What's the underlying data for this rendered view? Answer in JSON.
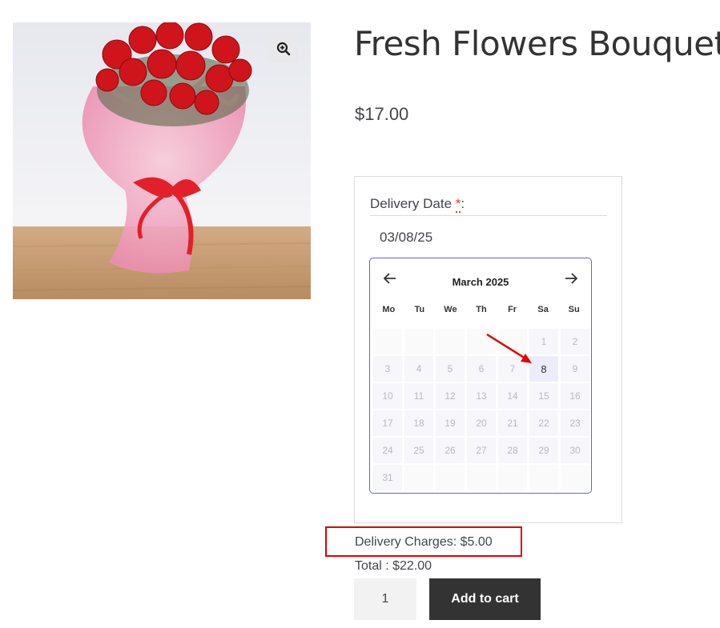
{
  "product": {
    "title": "Fresh Flowers Bouquet",
    "price": "$17.00",
    "image_icon": "bouquet-image",
    "zoom_icon": "zoom-in-icon"
  },
  "delivery": {
    "label": "Delivery Date ",
    "required_mark": "*",
    "colon": ":",
    "input_value": "03/08/25"
  },
  "calendar": {
    "month_label": "March 2025",
    "prev_icon": "arrow-left-icon",
    "next_icon": "arrow-right-icon",
    "weekdays": [
      "Mo",
      "Tu",
      "We",
      "Th",
      "Fr",
      "Sa",
      "Su"
    ],
    "leading_blanks": 5,
    "days": [
      "1",
      "2",
      "3",
      "4",
      "5",
      "6",
      "7",
      "8",
      "9",
      "10",
      "11",
      "12",
      "13",
      "14",
      "15",
      "16",
      "17",
      "18",
      "19",
      "20",
      "21",
      "22",
      "23",
      "24",
      "25",
      "26",
      "27",
      "28",
      "29",
      "30",
      "31"
    ],
    "selected_day": "8",
    "accent_color": "#6464c8"
  },
  "pricing": {
    "delivery_charges": "Delivery Charges: $5.00",
    "total": "Total : $22.00"
  },
  "cart": {
    "quantity": "1",
    "add_to_cart_label": "Add to cart"
  },
  "colors": {
    "annotation_red": "#e30000",
    "button_dark": "#333333"
  }
}
